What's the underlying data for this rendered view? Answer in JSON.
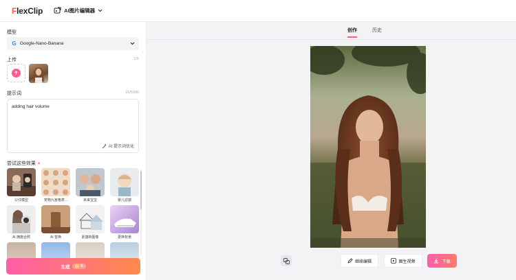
{
  "header": {
    "logo_text": "FlexClip",
    "app_name": "AI图片编辑器"
  },
  "sidebar": {
    "model_label": "模型",
    "model_value": "Google-Nano-Banana",
    "upload_label": "上传",
    "upload_count": "1/5",
    "prompt_label": "提示词",
    "prompt_count": "16/5000",
    "prompt_text": "adding hair volume",
    "optimize_label": "AI 提示词优化",
    "try_label": "尝试这些效果",
    "effects": [
      {
        "label": "公仔模型"
      },
      {
        "label": "宠物九宫格表..."
      },
      {
        "label": "未来宝宝"
      },
      {
        "label": "婴儿滤镜"
      },
      {
        "label": "AI 拥抱合照"
      },
      {
        "label": "AI 替换"
      },
      {
        "label": "素描转图像"
      },
      {
        "label": "更换背景"
      }
    ],
    "generate_label": "生成",
    "credits": "6"
  },
  "main": {
    "tabs": [
      {
        "label": "创作"
      },
      {
        "label": "历史"
      }
    ],
    "active_tab": "创作",
    "continue_edit_label": "继续编辑",
    "to_video_label": "图生视频",
    "download_label": "下载"
  },
  "colors": {
    "accent": "#ff5e8a",
    "brand_red": "#ff5a4a"
  }
}
